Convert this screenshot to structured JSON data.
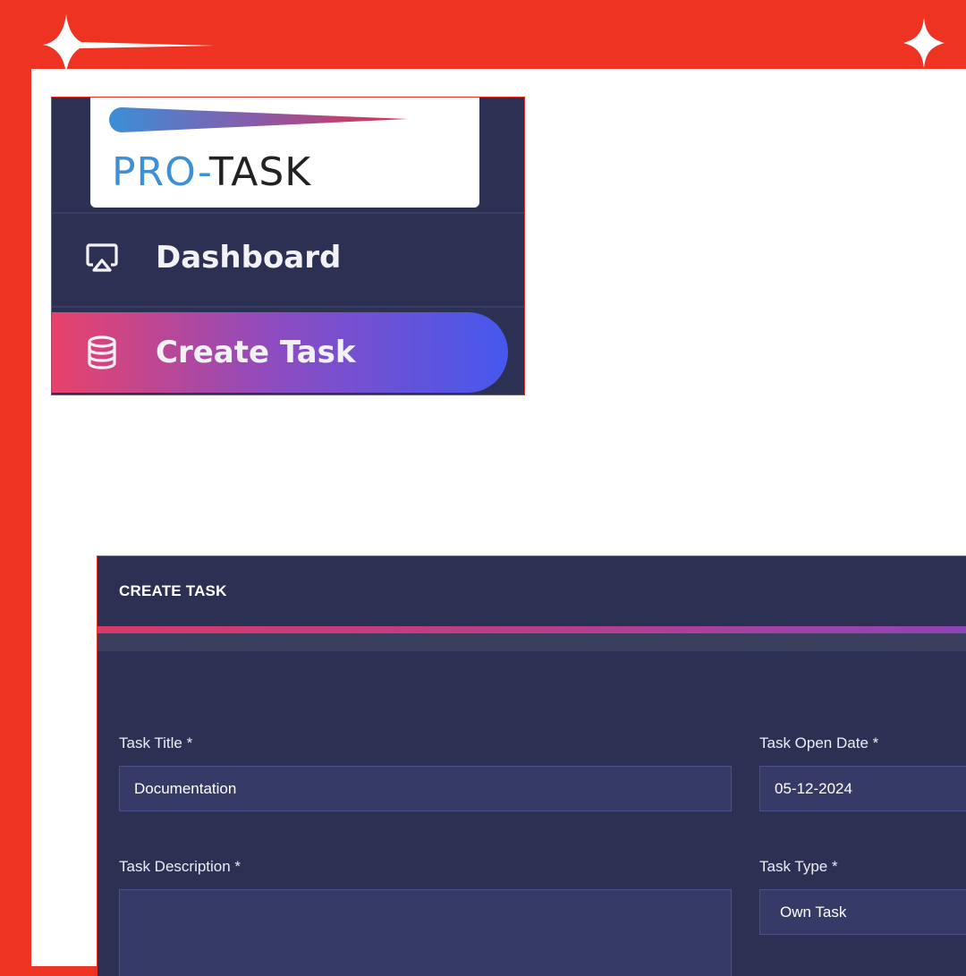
{
  "colors": {
    "frame": "#ef3323",
    "panel_bg": "#2c3052",
    "input_bg": "#353a66",
    "active_gradient_start": "#e8426a",
    "active_gradient_end": "#4658ee"
  },
  "sidebar": {
    "logo": {
      "text_pro": "PRO-",
      "text_task": "TASK"
    },
    "items": [
      {
        "label": "Dashboard",
        "icon": "monitor-cast-icon",
        "active": false
      },
      {
        "label": "Create Task",
        "icon": "database-icon",
        "active": true
      }
    ]
  },
  "form": {
    "title": "CREATE TASK",
    "fields": {
      "task_title": {
        "label": "Task Title *",
        "value": "Documentation"
      },
      "task_open_date": {
        "label": "Task Open Date *",
        "value": "05-12-2024"
      },
      "task_description": {
        "label": "Task Description *",
        "value": ""
      },
      "task_type": {
        "label": "Task Type *",
        "value": "Own Task"
      }
    }
  }
}
